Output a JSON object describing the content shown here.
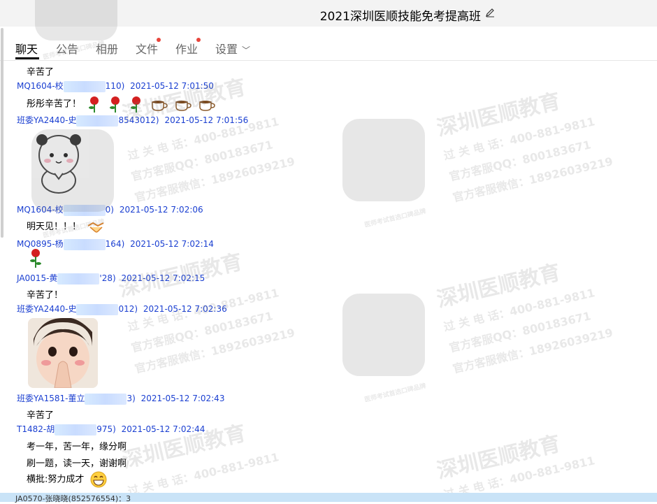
{
  "window": {
    "title": "2021深圳医顺技能免考提高班"
  },
  "tabs": [
    {
      "label": "聊天",
      "active": true
    },
    {
      "label": "公告",
      "active": false
    },
    {
      "label": "相册",
      "active": false
    },
    {
      "label": "文件",
      "active": false,
      "has_dot": true
    },
    {
      "label": "作业",
      "active": false,
      "has_dot": true
    },
    {
      "label": "设置",
      "active": false,
      "chevron": "chevron-down-icon"
    }
  ],
  "messages": [
    {
      "text": "辛苦了"
    },
    {
      "sender_prefix": "MQ1604-校",
      "sender_suffix": "110)",
      "time": "2021-05-12 7:01:50"
    },
    {
      "text": "彤彤辛苦了！",
      "icons": [
        "rose-icon",
        "rose-icon",
        "rose-icon",
        "coffee-icon",
        "coffee-icon",
        "coffee-icon"
      ]
    },
    {
      "sender_prefix": "班委YA2440-史",
      "sender_suffix": "8543012)",
      "time": "2021-05-12 7:01:56"
    },
    {
      "sender_prefix": "MQ1604-校",
      "sender_suffix": "0)",
      "time": "2021-05-12 7:02:06"
    },
    {
      "text": "明天见！！！",
      "icons": [
        "handshake-icon"
      ]
    },
    {
      "sender_prefix": "MQ0895-杨",
      "sender_suffix": "164)",
      "time": "2021-05-12 7:02:14"
    },
    {
      "icons": [
        "rose-icon"
      ]
    },
    {
      "sender_prefix": "JA0015-黄",
      "sender_suffix": "'28)",
      "time": "2021-05-12 7:02:15"
    },
    {
      "text": "辛苦了！"
    },
    {
      "sender_prefix": "班委YA2440-史",
      "sender_suffix": "012)",
      "time": "2021-05-12 7:02:36"
    },
    {
      "sender_prefix": "班委YA1581-董立",
      "sender_suffix": "3)",
      "time": "2021-05-12 7:02:43"
    },
    {
      "text": "辛苦了"
    },
    {
      "sender_prefix": "T1482-胡",
      "sender_suffix": "975)",
      "time": "2021-05-12 7:02:44"
    },
    {
      "text": "考一年，苦一年，缘分啊"
    },
    {
      "text": "刷一题，读一天，谢谢啊"
    },
    {
      "text": "横批:努力成才",
      "icons": [
        "grin-icon"
      ]
    }
  ],
  "bottom_strip": {
    "text": "JA0570-张晓晓(852576554)：3"
  },
  "watermark": {
    "brand": "深圳医顺教育",
    "phone": "过 关 电 话：400-881-9811",
    "qq": "官方客服QQ：800183671",
    "wechat": "官方客服微信：18926039219",
    "small": "医师考试首选口碑品牌"
  },
  "colors": {
    "sender": "#1a3fd1",
    "accent": "#000000",
    "dot": "#e8453c"
  }
}
